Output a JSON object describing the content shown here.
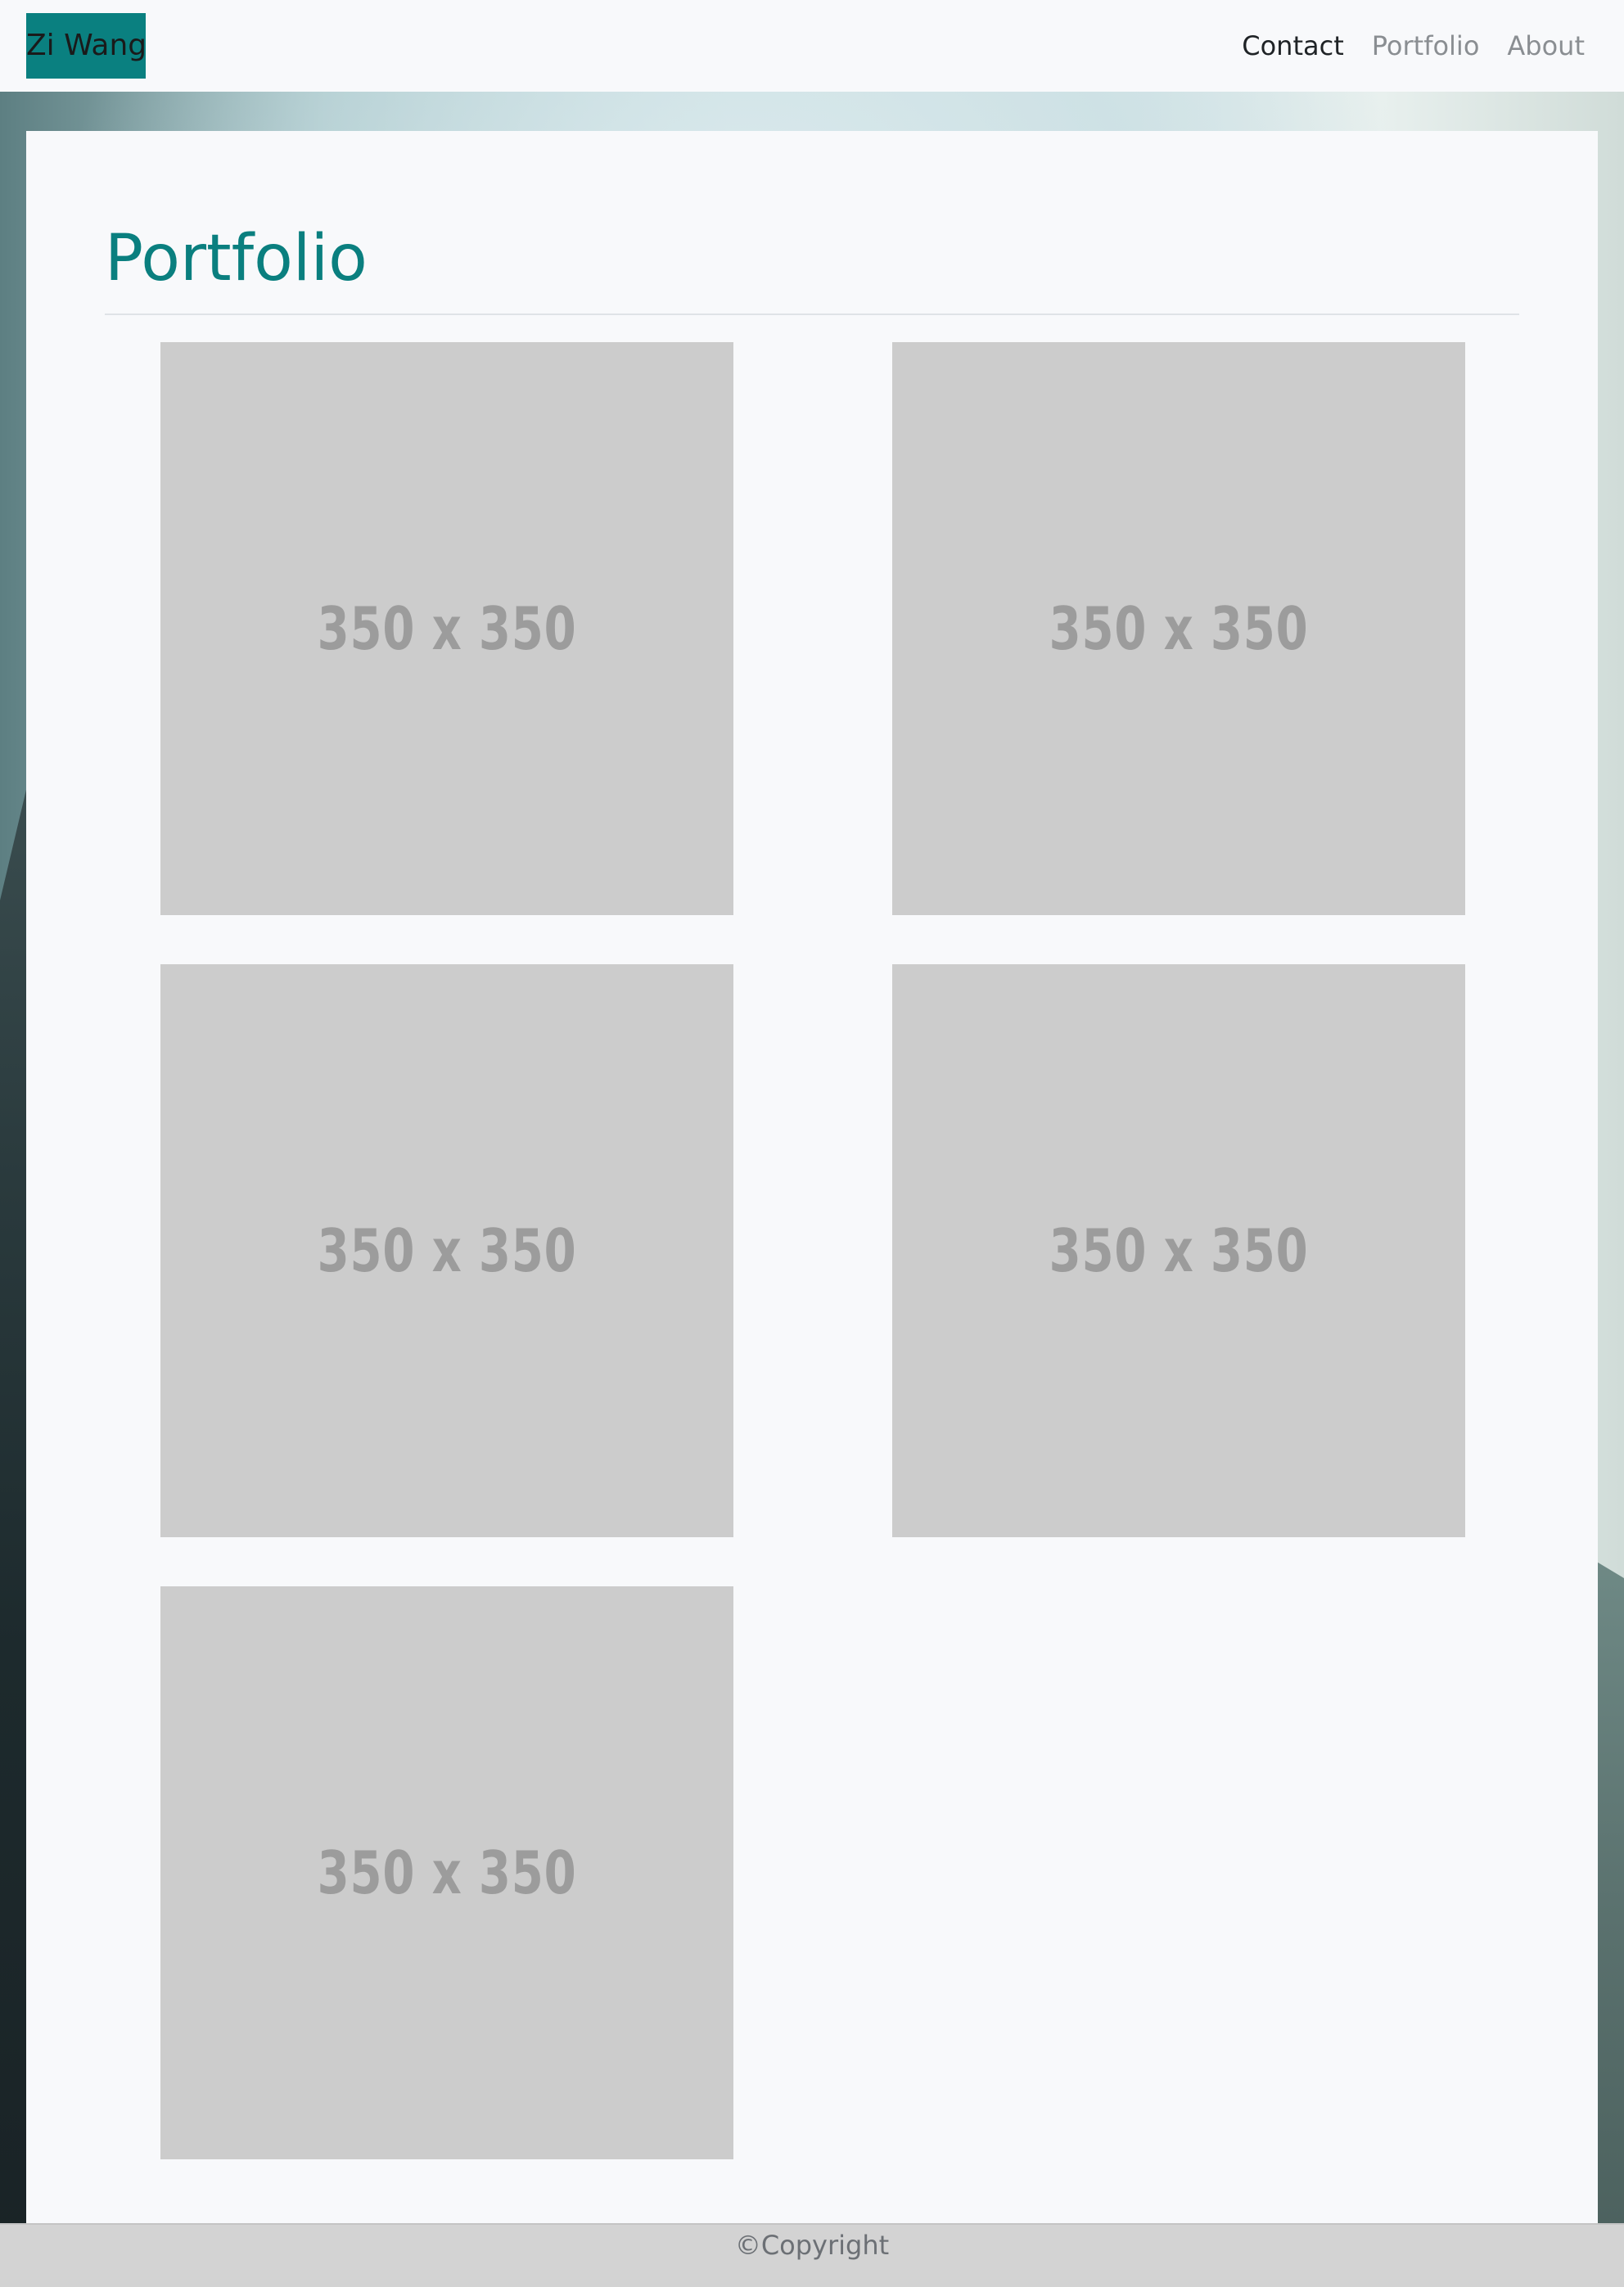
{
  "navbar": {
    "brand": "Zi Wang",
    "links": [
      {
        "label": "Contact",
        "active": true
      },
      {
        "label": "Portfolio",
        "active": false
      },
      {
        "label": "About",
        "active": false
      }
    ]
  },
  "main": {
    "title": "Portfolio",
    "thumbnails": [
      {
        "label": "350 x 350"
      },
      {
        "label": "350 x 350"
      },
      {
        "label": "350 x 350"
      },
      {
        "label": "350 x 350"
      },
      {
        "label": "350 x 350"
      }
    ]
  },
  "footer": {
    "text": "©Copyright"
  },
  "colors": {
    "accent": "#0a8080",
    "placeholder": "#cccccc",
    "footer": "#d3d3d3"
  }
}
